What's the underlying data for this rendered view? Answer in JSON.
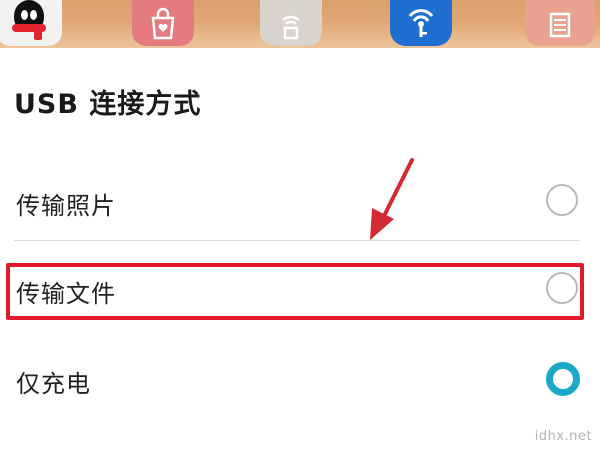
{
  "wallpaper": {
    "apps": [
      {
        "name": "qq-app-icon"
      },
      {
        "name": "shopping-app-icon"
      },
      {
        "name": "router-app-icon"
      },
      {
        "name": "wifi-key-app-icon"
      },
      {
        "name": "notes-app-icon"
      }
    ]
  },
  "dialog": {
    "title": "USB 连接方式",
    "options": [
      {
        "label": "传输照片",
        "selected": false
      },
      {
        "label": "传输文件",
        "selected": false,
        "highlighted": true
      },
      {
        "label": "仅充电",
        "selected": true
      }
    ]
  },
  "colors": {
    "accent": "#1aa9c6",
    "highlight": "#e21b2c",
    "arrow": "#d42a35"
  },
  "watermark": "idhx.net"
}
